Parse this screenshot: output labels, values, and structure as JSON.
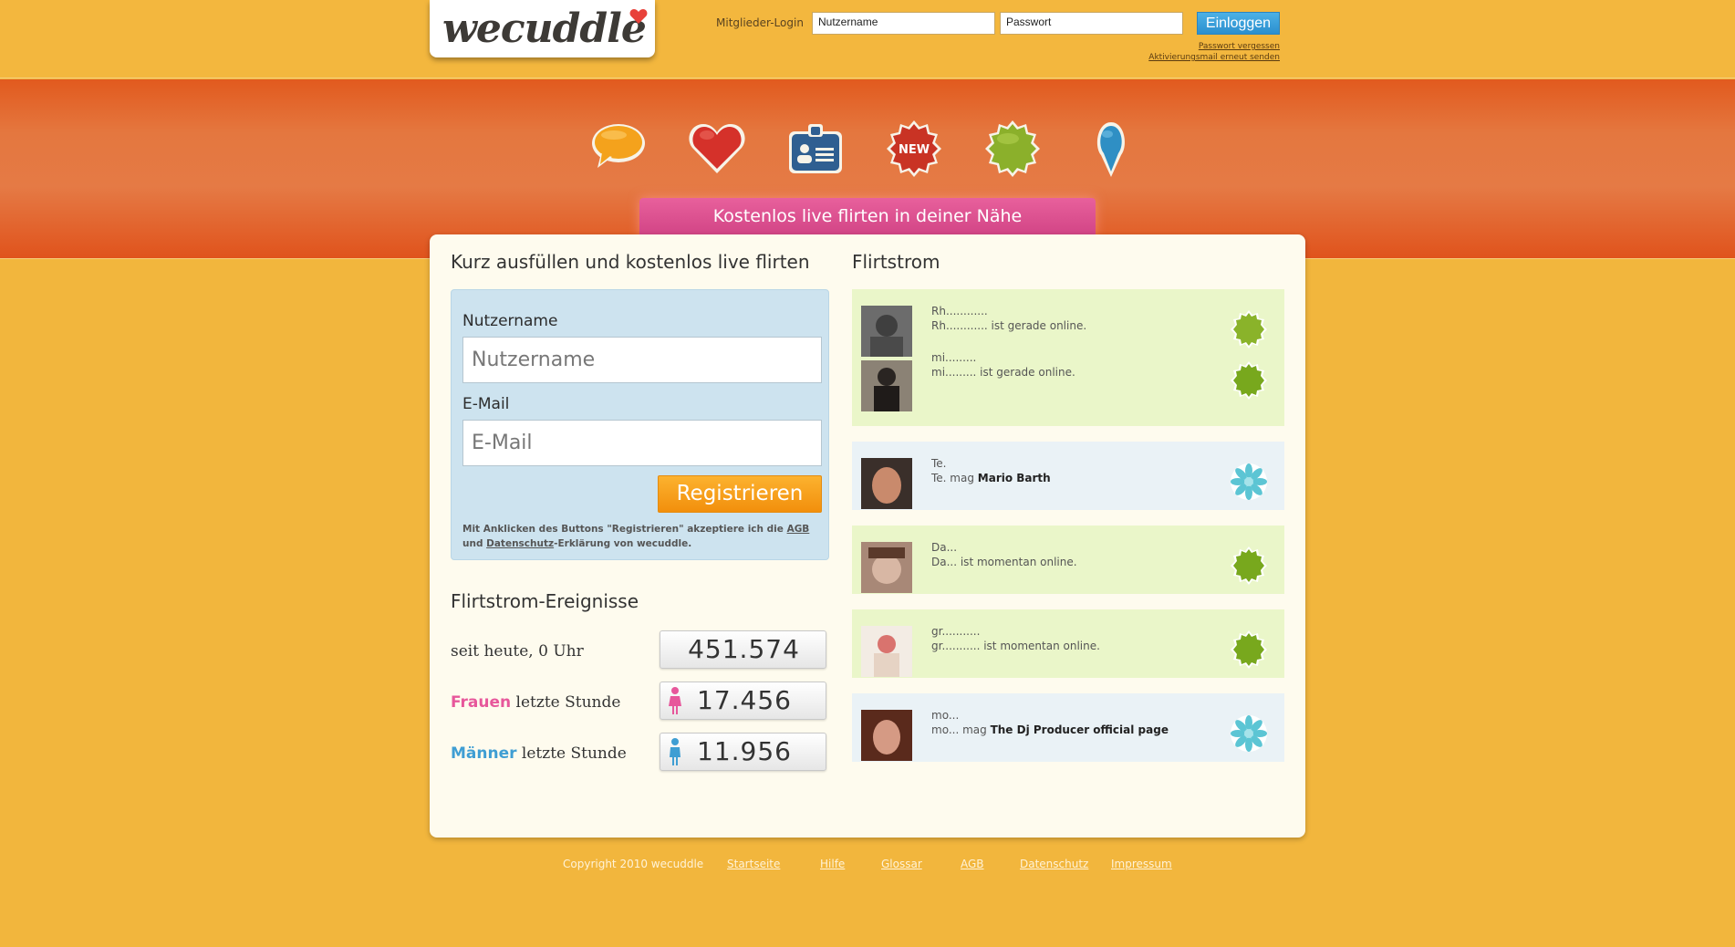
{
  "header": {
    "logo_text": "wecuddle",
    "login_label": "Mitglieder-Login",
    "username_placeholder": "Nutzername",
    "password_placeholder": "Passwort",
    "login_button": "Einloggen",
    "forgot_password": "Passwort vergessen",
    "resend_activation": "Aktivierungsmail erneut senden"
  },
  "banner": {
    "icons": [
      "chat-bubble-icon",
      "heart-icon",
      "id-card-icon",
      "new-badge-icon",
      "green-badge-icon",
      "map-pin-icon"
    ],
    "new_badge_text": "NEW",
    "headline": "Kostenlos live flirten in deiner Nähe"
  },
  "registration": {
    "title": "Kurz ausfüllen und kostenlos live flirten",
    "username_label": "Nutzername",
    "username_placeholder": "Nutzername",
    "email_label": "E-Mail",
    "email_placeholder": "E-Mail",
    "register_button": "Registrieren",
    "terms_prefix": "Mit Anklicken des Buttons \"Registrieren\" akzeptiere ich die ",
    "terms_agb": "AGB",
    "terms_and": " und ",
    "terms_privacy": "Datenschutz",
    "terms_suffix": "-Erklärung von wecuddle."
  },
  "events": {
    "title": "Flirtstrom-Ereignisse",
    "rows": [
      {
        "prefix": "",
        "label": "seit heute, 0 Uhr",
        "value": "451.574"
      },
      {
        "prefix": "Frauen",
        "label": " letzte Stunde",
        "value": "17.456"
      },
      {
        "prefix": "Männer",
        "label": " letzte Stunde",
        "value": "11.956"
      }
    ],
    "colors": {
      "women": "#e7579b",
      "men": "#3f9ed3"
    }
  },
  "stream": {
    "title": "Flirtstrom",
    "items": [
      {
        "name": "Rh............",
        "text": "Rh............ ist gerade online.",
        "bold": "",
        "type": "online",
        "bg": "green"
      },
      {
        "name": "mi.........",
        "text": "mi......... ist gerade online.",
        "bold": "",
        "type": "online",
        "bg": "green"
      },
      {
        "name": "Te.",
        "text": "Te. mag ",
        "bold": "Mario Barth",
        "type": "like",
        "bg": "blue"
      },
      {
        "name": "Da...",
        "text": "Da... ist momentan online.",
        "bold": "",
        "type": "online",
        "bg": "green"
      },
      {
        "name": "gr...........",
        "text": "gr........... ist momentan online.",
        "bold": "",
        "type": "online",
        "bg": "green"
      },
      {
        "name": "mo...",
        "text": "mo... mag ",
        "bold": "The Dj Producer official page",
        "type": "like",
        "bg": "blue"
      }
    ]
  },
  "footer": {
    "copyright": "Copyright 2010 wecuddle",
    "links": [
      "Startseite",
      "Hilfe",
      "Glossar",
      "AGB",
      "Datenschutz",
      "Impressum"
    ]
  }
}
